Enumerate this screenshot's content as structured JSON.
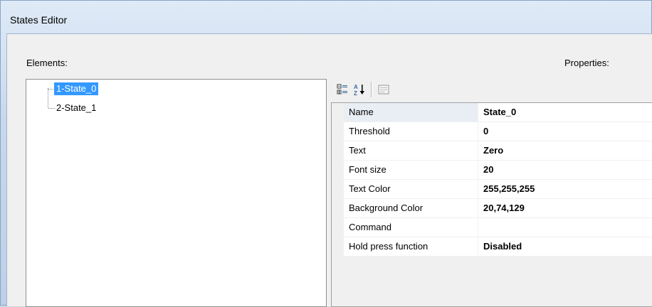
{
  "window": {
    "title": "States Editor"
  },
  "labels": {
    "elements": "Elements:",
    "properties": "Properties:"
  },
  "tree": {
    "items": [
      {
        "label": "1-State_0",
        "selected": true
      },
      {
        "label": "2-State_1",
        "selected": false
      }
    ]
  },
  "toolbar": {
    "categorized_icon": "categorized-icon",
    "alphabetical_icon": "alphabetical-sort-icon",
    "property_pages_icon": "property-pages-icon"
  },
  "properties": [
    {
      "name": "Name",
      "value": "State_0"
    },
    {
      "name": "Threshold",
      "value": "0"
    },
    {
      "name": "Text",
      "value": "Zero"
    },
    {
      "name": "Font size",
      "value": "20"
    },
    {
      "name": "Text Color",
      "value": "255,255,255"
    },
    {
      "name": "Background Color",
      "value": "20,74,129"
    },
    {
      "name": "Command",
      "value": ""
    },
    {
      "name": "Hold press function",
      "value": "Disabled"
    }
  ],
  "colors": {
    "selection": "#3399ff",
    "titlebar": "#c7d8ec"
  }
}
